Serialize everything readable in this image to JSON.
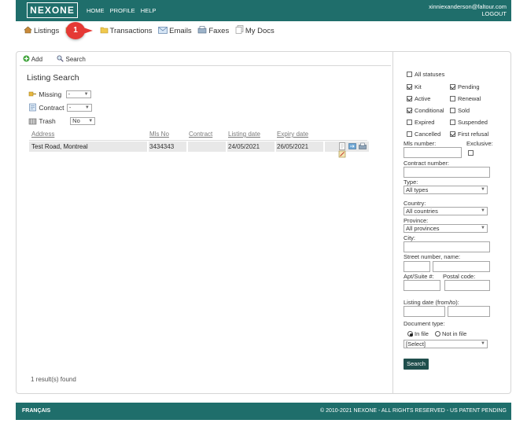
{
  "header": {
    "logo": "NEXONE",
    "nav": [
      "HOME",
      "PROFILE",
      "HELP"
    ],
    "email": "xinniexanderson@faltour.com",
    "logout": "LOGOUT"
  },
  "mainnav": {
    "listings": "Listings",
    "transactions": "Transactions",
    "emails": "Emails",
    "faxes": "Faxes",
    "mydocs": "My Docs",
    "callout": "1"
  },
  "toolbar": {
    "add": "Add",
    "search": "Search"
  },
  "listing_search": {
    "title": "Listing Search",
    "filters": [
      {
        "label": "Missing",
        "value": "-"
      },
      {
        "label": "Contract",
        "value": "-"
      },
      {
        "label": "Trash",
        "value": "No"
      }
    ]
  },
  "table": {
    "headers": [
      "Address",
      "Mls No",
      "Contract",
      "Listing date",
      "Expiry date"
    ],
    "rows": [
      {
        "address": "Test Road, Montreal",
        "mls": "3434343",
        "contract": "",
        "listing_date": "24/05/2021",
        "expiry_date": "26/05/2021"
      }
    ]
  },
  "results": "1 result(s) found",
  "filters_panel": {
    "all_statuses": "All statuses",
    "statuses": [
      {
        "label": "Kit",
        "checked": true
      },
      {
        "label": "Pending",
        "checked": true
      },
      {
        "label": "Active",
        "checked": true
      },
      {
        "label": "Renewal",
        "checked": false
      },
      {
        "label": "Conditional",
        "checked": true
      },
      {
        "label": "Sold",
        "checked": false
      },
      {
        "label": "Expired",
        "checked": false
      },
      {
        "label": "Suspended",
        "checked": false
      },
      {
        "label": "Cancelled",
        "checked": false
      },
      {
        "label": "First refusal",
        "checked": true
      }
    ],
    "mls_number": "Mls number:",
    "exclusive": "Exclusive:",
    "contract_number": "Contract number:",
    "type_label": "Type:",
    "type_value": "All types",
    "country_label": "Country:",
    "country_value": "All countries",
    "province_label": "Province:",
    "province_value": "All provinces",
    "city_label": "City:",
    "street_label": "Street number, name:",
    "apt_label": "Apt/Suite #:",
    "postal_label": "Postal code:",
    "listing_date_label": "Listing date (from/to):",
    "doc_type_label": "Document type:",
    "in_file": "In file",
    "not_in_file": "Not in file",
    "doc_select": "[Select]",
    "search_button": "Search"
  },
  "footer": {
    "language": "FRANÇAIS",
    "copyright": "© 2010-2021 NEXONE - ALL RIGHTS RESERVED - US PATENT PENDING"
  },
  "colors": {
    "brand": "#1f6e6b",
    "callout": "#e53935",
    "button": "#1f4e4c"
  }
}
